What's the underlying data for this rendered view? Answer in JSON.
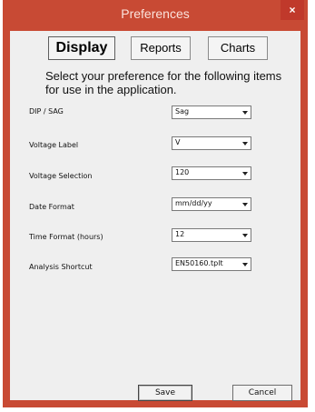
{
  "window": {
    "title": "Preferences",
    "close_label": "×"
  },
  "tabs": [
    {
      "label": "Display",
      "active": true
    },
    {
      "label": "Reports",
      "active": false
    },
    {
      "label": "Charts",
      "active": false
    }
  ],
  "intro_text": "Select your preference for the following items for use in the application.",
  "fields": [
    {
      "label": "DIP / SAG",
      "value": "Sag"
    },
    {
      "label": "Voltage Label",
      "value": "V"
    },
    {
      "label": "Voltage Selection",
      "value": "120"
    },
    {
      "label": "Date Format",
      "value": "mm/dd/yy"
    },
    {
      "label": "Time Format (hours)",
      "value": "12"
    },
    {
      "label": "Analysis Shortcut",
      "value": "EN50160.tplt"
    }
  ],
  "buttons": {
    "save": "Save",
    "cancel": "Cancel"
  },
  "colors": {
    "titlebar": "#c84a34",
    "close": "#c0392b",
    "client": "#efefef"
  }
}
